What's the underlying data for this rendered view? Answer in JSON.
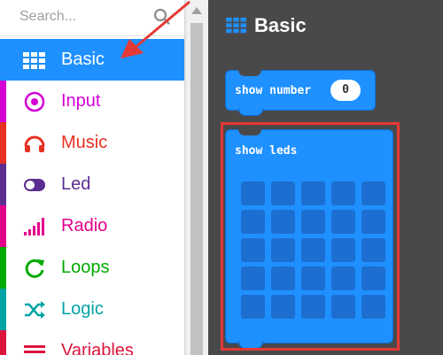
{
  "search": {
    "placeholder": "Search..."
  },
  "categories": [
    {
      "label": "Basic",
      "color": "#1e90ff",
      "text_color": "#ffffff",
      "selected": true,
      "icon": "grid-icon"
    },
    {
      "label": "Input",
      "color": "#d400d4",
      "text_color": "#d400d4",
      "selected": false,
      "icon": "radio-target-icon"
    },
    {
      "label": "Music",
      "color": "#e63022",
      "text_color": "#e63022",
      "selected": false,
      "icon": "headphones-icon"
    },
    {
      "label": "Led",
      "color": "#5c2d91",
      "text_color": "#5c2d91",
      "selected": false,
      "icon": "toggle-icon"
    },
    {
      "label": "Radio",
      "color": "#e3008c",
      "text_color": "#e3008c",
      "selected": false,
      "icon": "signal-bars-icon"
    },
    {
      "label": "Loops",
      "color": "#00aa00",
      "text_color": "#00aa00",
      "selected": false,
      "icon": "refresh-icon"
    },
    {
      "label": "Logic",
      "color": "#00a4a6",
      "text_color": "#00a4a6",
      "selected": false,
      "icon": "shuffle-icon"
    },
    {
      "label": "Variables",
      "color": "#dc143c",
      "text_color": "#dc143c",
      "selected": false,
      "icon": "list-lines-icon"
    }
  ],
  "flyout": {
    "title": "Basic",
    "blocks": {
      "show_number": {
        "label": "show number",
        "value": "0"
      },
      "show_leds": {
        "label": "show leds"
      }
    }
  },
  "colors": {
    "accent": "#1e90ff",
    "flyout_bg": "#4a4949",
    "highlight": "#e53935"
  }
}
